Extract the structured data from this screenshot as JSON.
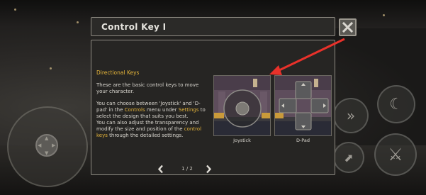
{
  "dialog": {
    "title": "Control Key I",
    "close_icon": "close-x-icon",
    "section_title": "Directional Keys",
    "para1": "These are the basic control keys to move your character.",
    "para2_lines": [
      [
        "You can choose between 'Joystick' and 'D-",
        ""
      ],
      [
        "pad' in the ",
        "Controls",
        " menu under ",
        "Settings",
        " to"
      ],
      [
        "select the design that suits you best.",
        ""
      ]
    ],
    "para3_lines": [
      [
        "You can also adjust the transparency and",
        ""
      ],
      [
        "modify the size and position of the ",
        "control"
      ],
      [
        "keys",
        " through the detailed settings."
      ]
    ],
    "thumb_joystick_caption": "Joystick",
    "thumb_dpad_caption": "D-Pad",
    "pager": {
      "text": "1 / 2",
      "prev_icon": "chevron-left-icon",
      "next_icon": "chevron-right-icon"
    }
  },
  "colors": {
    "highlight": "#e4b43a",
    "annotation_arrow": "#e8312a"
  }
}
